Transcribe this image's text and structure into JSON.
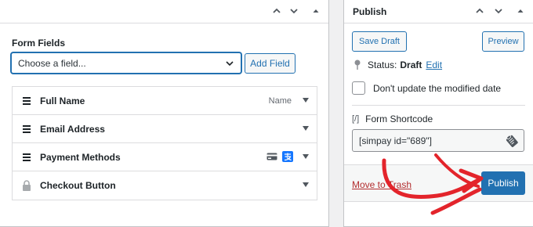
{
  "left": {
    "section_title": "Form Fields",
    "select_value": "Choose a field...",
    "add_field_label": "Add Field",
    "fields": [
      {
        "label": "Full Name",
        "hint": "Name",
        "icon": "drag-handle-icon"
      },
      {
        "label": "Email Address",
        "hint": "",
        "icon": "drag-handle-icon"
      },
      {
        "label": "Payment Methods",
        "hint": "",
        "icon": "drag-handle-icon",
        "extra_icons": [
          "credit-card-icon",
          "alipay-icon"
        ]
      },
      {
        "label": "Checkout Button",
        "hint": "",
        "icon": "lock-icon"
      }
    ]
  },
  "publish": {
    "title": "Publish",
    "save_draft_label": "Save Draft",
    "preview_label": "Preview",
    "status_label": "Status:",
    "status_value": "Draft",
    "status_edit": "Edit",
    "modified_label": "Don't update the modified date",
    "shortcode_icon": "[/]",
    "shortcode_title": "Form Shortcode",
    "shortcode_value": "[simpay id=\"689\"]",
    "trash_label": "Move to Trash",
    "publish_label": "Publish"
  },
  "colors": {
    "accent": "#2271b1",
    "danger": "#b32d2e",
    "annotation_arrow": "#e3242b"
  }
}
